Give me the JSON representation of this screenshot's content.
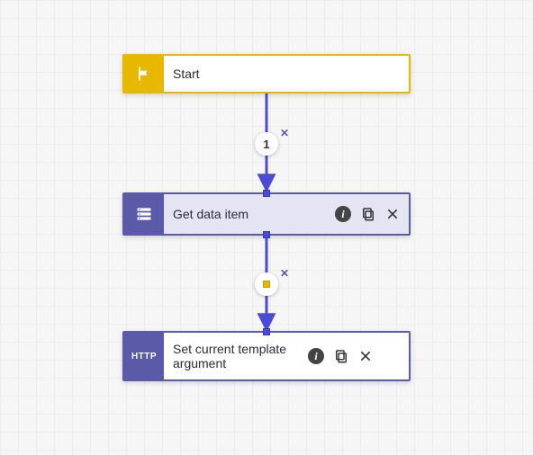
{
  "nodes": {
    "start": {
      "label": "Start",
      "icon": "flag-icon"
    },
    "get_data": {
      "label": "Get data item",
      "icon": "database-icon"
    },
    "set_arg": {
      "label": "Set current template argument",
      "icon": "http-icon",
      "iconText": "HTTP"
    }
  },
  "connectors": {
    "c1": {
      "badge": "1"
    },
    "c2": {
      "badge": ""
    }
  },
  "colors": {
    "start": "#e6b800",
    "purple": "#5a5aa8",
    "arrow": "#4b4bd6"
  }
}
